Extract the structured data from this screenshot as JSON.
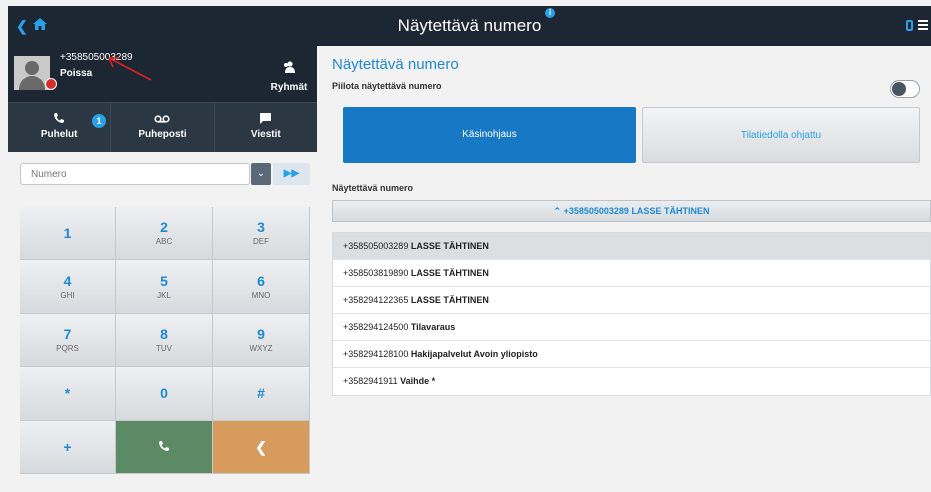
{
  "header": {
    "title": "Näytettävä numero"
  },
  "profile": {
    "number": "+358505003289",
    "status": "Poissa",
    "groups_label": "Ryhmät"
  },
  "tabs": [
    {
      "label": "Puhelut",
      "badge": "1"
    },
    {
      "label": "Puheposti"
    },
    {
      "label": "Viestit"
    }
  ],
  "dial": {
    "placeholder": "Numero"
  },
  "keypad": [
    {
      "digit": "1",
      "letters": ""
    },
    {
      "digit": "2",
      "letters": "ABC"
    },
    {
      "digit": "3",
      "letters": "DEF"
    },
    {
      "digit": "4",
      "letters": "GHI"
    },
    {
      "digit": "5",
      "letters": "JKL"
    },
    {
      "digit": "6",
      "letters": "MNO"
    },
    {
      "digit": "7",
      "letters": "PQRS"
    },
    {
      "digit": "8",
      "letters": "TUV"
    },
    {
      "digit": "9",
      "letters": "WXYZ"
    },
    {
      "digit": "*",
      "letters": ""
    },
    {
      "digit": "0",
      "letters": ""
    },
    {
      "digit": "#",
      "letters": ""
    },
    {
      "digit": "+",
      "letters": ""
    }
  ],
  "main": {
    "title": "Näytettävä numero",
    "hide_label": "Piilota näytettävä numero",
    "manual_label": "Käsinohjaus",
    "status_label": "Tilatiedolla ohjattu",
    "shown_label": "Näytettävä numero",
    "selected": {
      "number": "+358505003289",
      "name": "LASSE TÄHTINEN"
    },
    "numbers": [
      {
        "number": "+358505003289",
        "name": "LASSE TÄHTINEN"
      },
      {
        "number": "+358503819890",
        "name": "LASSE TÄHTINEN"
      },
      {
        "number": "+358294122365",
        "name": "LASSE TÄHTINEN"
      },
      {
        "number": "+358294124500",
        "name": "Tilavaraus"
      },
      {
        "number": "+358294128100",
        "name": "Hakijapalvelut Avoin yliopisto"
      },
      {
        "number": "+3582941911",
        "name": "Vaihde *"
      }
    ]
  }
}
